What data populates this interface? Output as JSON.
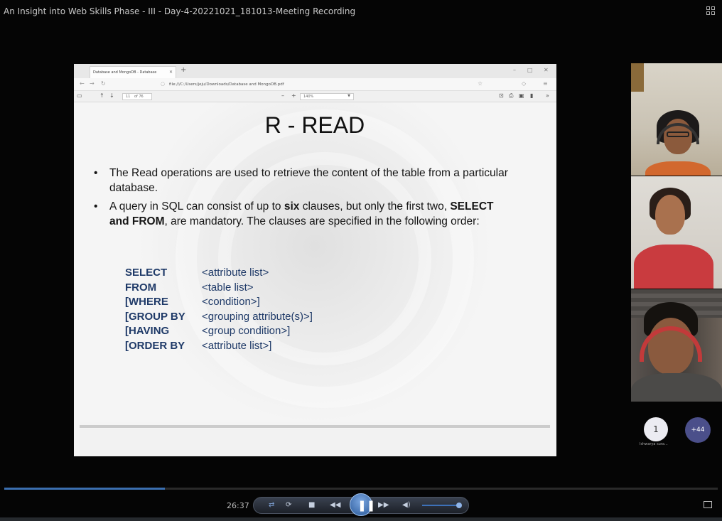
{
  "window": {
    "title": "An Insight into Web Skills Phase - III - Day-4-20221021_181013-Meeting Recording"
  },
  "browser": {
    "tab_title": "Database and MongoDB - Database",
    "url": "file:///C:/Users/jeju/Downloads/Database and MongoDB.pdf",
    "page_current": "11",
    "page_total": "of 76",
    "zoom": "140%"
  },
  "slide": {
    "title": "R - READ",
    "bullet1": "The Read operations are used to retrieve the content of the table from a particular database.",
    "bullet2_pre": "A query in SQL can consist of up to ",
    "bullet2_bold1": "six",
    "bullet2_mid": " clauses, but only the first two, ",
    "bullet2_bold2": "SELECT and FROM",
    "bullet2_post": ", are mandatory. The clauses are specified in the following order:",
    "sql": [
      {
        "kw": "SELECT",
        "arg": "<attribute list>"
      },
      {
        "kw": "FROM",
        "arg": "<table list>"
      },
      {
        "kw": "[WHERE",
        "arg": "<condition>]"
      },
      {
        "kw": "[GROUP BY",
        "arg": "<grouping attribute(s)>]"
      },
      {
        "kw": "[HAVING",
        "arg": "<group condition>]"
      },
      {
        "kw": "[ORDER BY",
        "arg": "<attribute list>]"
      }
    ]
  },
  "participants": {
    "count_badge": "1",
    "more_badge": "+44",
    "name_label": "Ishwarya sura..."
  },
  "player": {
    "time": "26:37",
    "progress": 0.225,
    "volume": 0.9
  },
  "colors": {
    "accent": "#3b6fb0",
    "sql_blue": "#1f3a68"
  }
}
